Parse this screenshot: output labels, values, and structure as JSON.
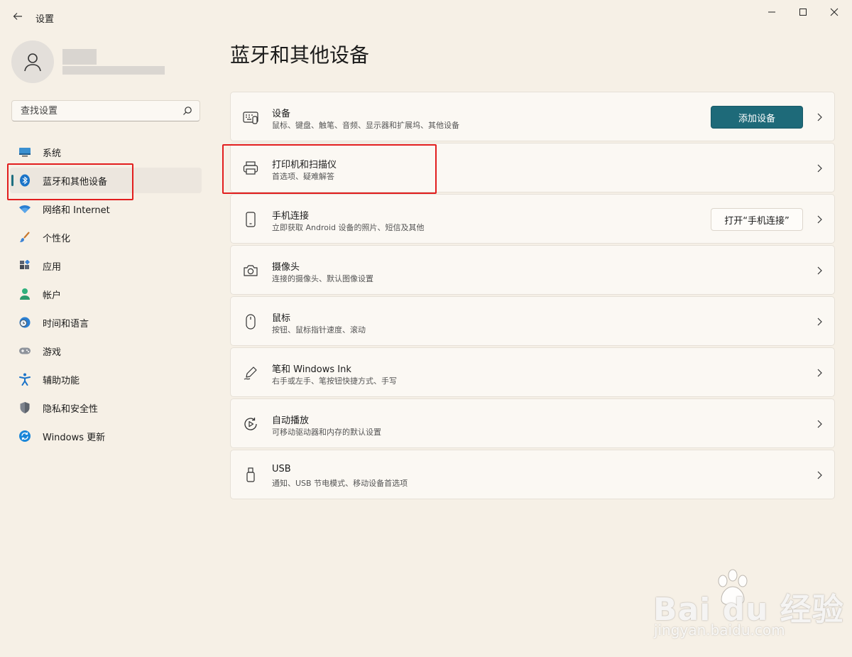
{
  "window": {
    "title": "设置",
    "back_icon": "back-arrow-icon",
    "controls": [
      "minimize-icon",
      "maximize-icon",
      "close-icon"
    ]
  },
  "profile": {
    "avatar_icon": "user-icon"
  },
  "search": {
    "placeholder": "查找设置",
    "value": "",
    "icon": "search-icon"
  },
  "sidebar": {
    "items": [
      {
        "label": "系统",
        "icon": "system-icon",
        "active": false
      },
      {
        "label": "蓝牙和其他设备",
        "icon": "bluetooth-icon",
        "active": true
      },
      {
        "label": "网络和 Internet",
        "icon": "wifi-icon",
        "active": false
      },
      {
        "label": "个性化",
        "icon": "brush-icon",
        "active": false
      },
      {
        "label": "应用",
        "icon": "apps-icon",
        "active": false
      },
      {
        "label": "帐户",
        "icon": "account-icon",
        "active": false
      },
      {
        "label": "时间和语言",
        "icon": "time-language-icon",
        "active": false
      },
      {
        "label": "游戏",
        "icon": "gamepad-icon",
        "active": false
      },
      {
        "label": "辅助功能",
        "icon": "accessibility-icon",
        "active": false
      },
      {
        "label": "隐私和安全性",
        "icon": "shield-icon",
        "active": false
      },
      {
        "label": "Windows 更新",
        "icon": "update-icon",
        "active": false
      }
    ]
  },
  "main": {
    "title": "蓝牙和其他设备",
    "cards": [
      {
        "title": "设备",
        "subtitle": "鼠标、键盘、触笔、音频、显示器和扩展坞、其他设备",
        "icon": "devices-icon",
        "button": "添加设备"
      },
      {
        "title": "打印机和扫描仪",
        "subtitle": "首选项、疑难解答",
        "icon": "printer-icon"
      },
      {
        "title": "手机连接",
        "subtitle": "立即获取 Android 设备的照片、短信及其他",
        "icon": "phone-icon",
        "button": "打开“手机连接”"
      },
      {
        "title": "摄像头",
        "subtitle": "连接的摄像头、默认图像设置",
        "icon": "camera-icon"
      },
      {
        "title": "鼠标",
        "subtitle": "按钮、鼠标指针速度、滚动",
        "icon": "mouse-icon"
      },
      {
        "title": "笔和 Windows Ink",
        "subtitle": "右手或左手、笔按钮快捷方式、手写",
        "icon": "pen-icon"
      },
      {
        "title": "自动播放",
        "subtitle": "可移动驱动器和内存的默认设置",
        "icon": "autoplay-icon"
      },
      {
        "title": "USB",
        "subtitle": "通知、USB 节电模式、移动设备首选项",
        "icon": "usb-icon"
      }
    ]
  },
  "watermark": {
    "logo_text": "Bai du 经验",
    "url_text": "jingyan.baidu.com"
  },
  "colors": {
    "accent": "#1e6a79",
    "highlight_box": "#e21e1e",
    "background": "#f6f0e6"
  }
}
